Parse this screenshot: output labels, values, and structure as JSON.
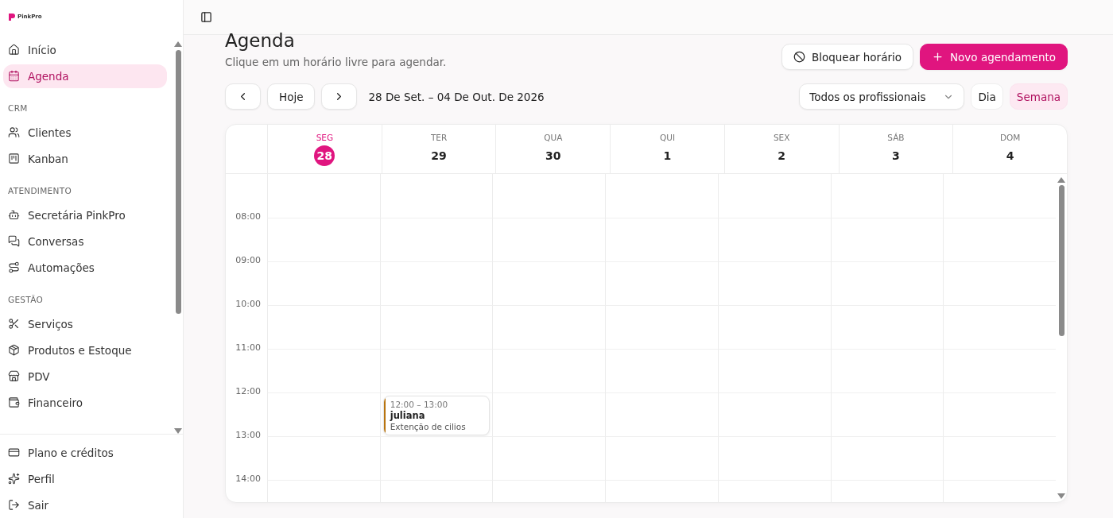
{
  "brand": {
    "name": "PinkPro"
  },
  "sidebar": {
    "items": [
      {
        "kind": "item",
        "label": "Início",
        "selected": false
      },
      {
        "kind": "item",
        "label": "Agenda",
        "selected": true
      },
      {
        "kind": "section",
        "label": "CRM"
      },
      {
        "kind": "item",
        "label": "Clientes",
        "selected": false
      },
      {
        "kind": "item",
        "label": "Kanban",
        "selected": false
      },
      {
        "kind": "section",
        "label": "ATENDIMENTO"
      },
      {
        "kind": "item",
        "label": "Secretária PinkPro",
        "selected": false
      },
      {
        "kind": "item",
        "label": "Conversas",
        "selected": false
      },
      {
        "kind": "item",
        "label": "Automações",
        "selected": false
      },
      {
        "kind": "section",
        "label": "GESTÃO"
      },
      {
        "kind": "item",
        "label": "Serviços",
        "selected": false
      },
      {
        "kind": "item",
        "label": "Produtos e Estoque",
        "selected": false
      },
      {
        "kind": "item",
        "label": "PDV",
        "selected": false
      },
      {
        "kind": "item",
        "label": "Financeiro",
        "selected": false
      }
    ],
    "footer": [
      {
        "label": "Plano e créditos"
      },
      {
        "label": "Perfil"
      },
      {
        "label": "Sair"
      }
    ]
  },
  "page": {
    "title": "Agenda",
    "subtitle": "Clique em um horário livre para agendar."
  },
  "actions": [
    {
      "kind": "secondary",
      "label": "Bloquear horário"
    },
    {
      "kind": "primary",
      "label": "Novo agendamento"
    }
  ],
  "nav": {
    "today": "Hoje",
    "range": "28 De Set. – 04 De Out. De 2026"
  },
  "filter": {
    "value": "Todos os profissionais"
  },
  "views": [
    {
      "label": "Dia",
      "selected": false
    },
    {
      "label": "Semana",
      "selected": true
    }
  ],
  "days": [
    {
      "weekday": "SEG",
      "date": "28",
      "today": true
    },
    {
      "weekday": "TER",
      "date": "29",
      "today": false
    },
    {
      "weekday": "QUA",
      "date": "30",
      "today": false
    },
    {
      "weekday": "QUI",
      "date": "1",
      "today": false
    },
    {
      "weekday": "SEX",
      "date": "2",
      "today": false
    },
    {
      "weekday": "SÁB",
      "date": "3",
      "today": false
    },
    {
      "weekday": "DOM",
      "date": "4",
      "today": false
    }
  ],
  "hours": [
    "08:00",
    "09:00",
    "10:00",
    "11:00",
    "12:00",
    "13:00",
    "14:00"
  ],
  "events": [
    {
      "time": "12:00 – 13:00",
      "client": "juliana",
      "service": "Extenção de cilios",
      "color": "#b8740f"
    }
  ]
}
